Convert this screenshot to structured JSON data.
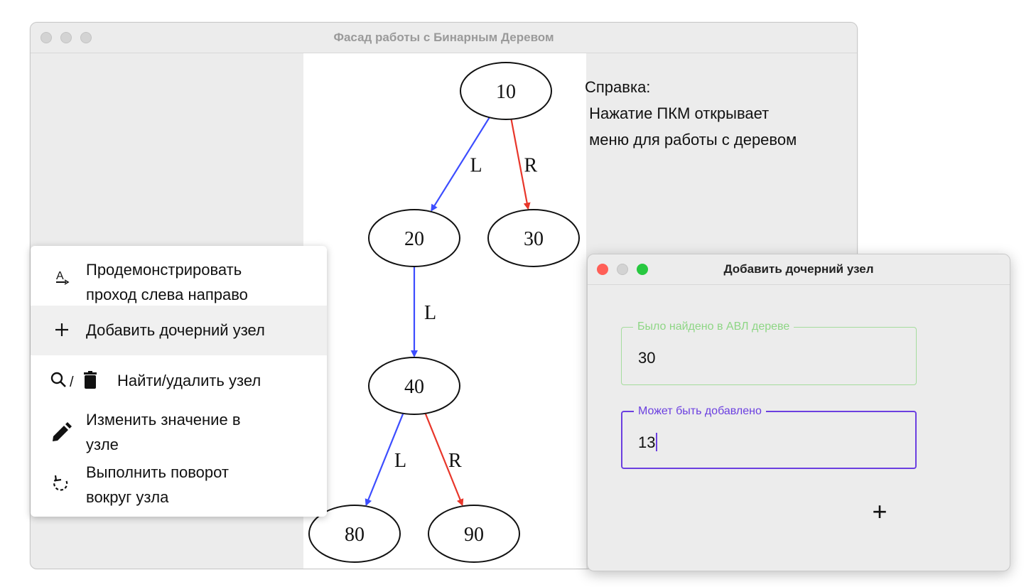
{
  "main_window": {
    "title": "Фасад работы с Бинарным Деревом",
    "help": {
      "heading": "Справка:",
      "line1": " Нажатие ПКМ открывает",
      "line2": " меню для работы с деревом"
    },
    "tree": {
      "nodes": [
        {
          "id": "n10",
          "label": "10"
        },
        {
          "id": "n20",
          "label": "20"
        },
        {
          "id": "n30",
          "label": "30"
        },
        {
          "id": "n40",
          "label": "40"
        },
        {
          "id": "n80",
          "label": "80"
        },
        {
          "id": "n90",
          "label": "90"
        }
      ],
      "edges": [
        {
          "from": "n10",
          "to": "n20",
          "label": "L",
          "color": "#3c4dff"
        },
        {
          "from": "n10",
          "to": "n30",
          "label": "R",
          "color": "#e8362a"
        },
        {
          "from": "n20",
          "to": "n40",
          "label": "L",
          "color": "#3c4dff"
        },
        {
          "from": "n40",
          "to": "n80",
          "label": "L",
          "color": "#3c4dff"
        },
        {
          "from": "n40",
          "to": "n90",
          "label": "R",
          "color": "#e8362a"
        }
      ]
    }
  },
  "context_menu": {
    "items": [
      {
        "icon": "text-direction-icon",
        "line1": "Продемонстрировать",
        "line2": "проход слева направо"
      },
      {
        "icon": "plus-icon",
        "line1": "Добавить дочерний узел",
        "highlighted": true
      },
      {
        "icon": "search-delete-icon",
        "line1": "Найти/удалить узел"
      },
      {
        "icon": "pencil-icon",
        "line1": "Изменить значение в",
        "line2": "узле"
      },
      {
        "icon": "rotate-icon",
        "line1": "Выполнить поворот",
        "line2": "вокруг узла"
      }
    ]
  },
  "dialog": {
    "title": "Добавить дочерний узел",
    "found_field": {
      "legend": "Было найдено в АВЛ дереве",
      "value": "30"
    },
    "add_field": {
      "legend": "Может быть добавлено",
      "value": "13"
    },
    "add_button": "+",
    "colors": {
      "found_border": "#a5dc9d",
      "focus_border": "#6b3fe0",
      "close": "#ff5f57",
      "zoom": "#28c840"
    }
  }
}
